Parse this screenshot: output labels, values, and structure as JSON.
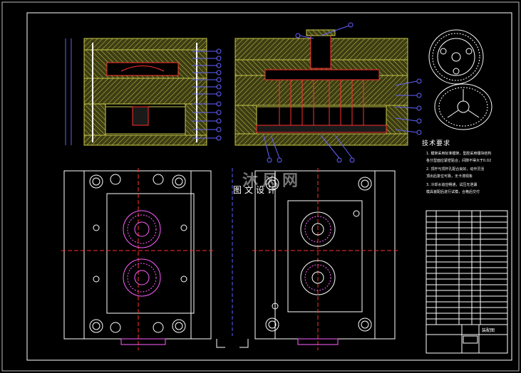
{
  "colors": {
    "background": "#000000",
    "frame": "#ffffff",
    "plate_hatch": "#c8c84a",
    "plate_fill": "#4a4a1a",
    "leader": "#6060ff",
    "detail": "#ff3030",
    "cavity": "#ff60ff",
    "table": "#ffffff"
  },
  "watermark": {
    "site_logo": "沐风网",
    "site_name": "图文设计"
  },
  "tech_requirements": {
    "title": "技术要求",
    "notes": [
      "1. 模架采用标准模架，型腔采用镶块结构",
      "   各分型面应紧密贴合，间隙不得大于0.02",
      "2. 顶杆与顶杆孔配合良好，动作灵活",
      "   顶出后复位可靠，无卡滞现象",
      "3. 冷却水道应畅通，试压无泄漏",
      "   模具装配后进行试模，合格后交付"
    ]
  },
  "title_block": {
    "drawing_title": "装配图"
  }
}
